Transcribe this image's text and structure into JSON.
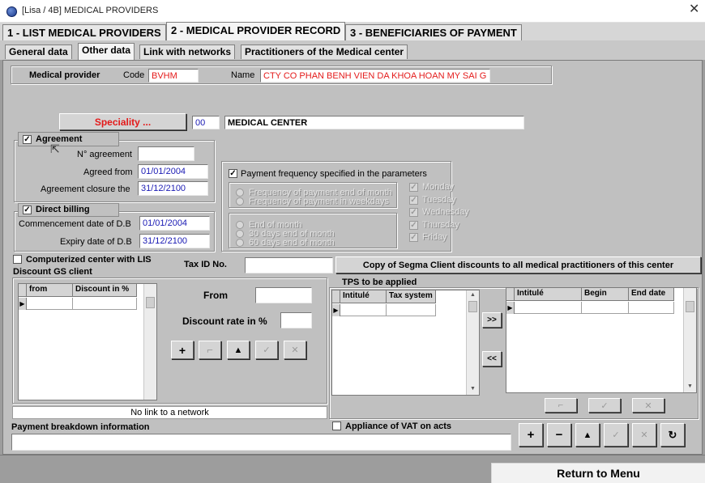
{
  "window": {
    "title": "[Lisa / 4B] MEDICAL PROVIDERS",
    "close": "✕"
  },
  "main_tabs": [
    {
      "label": "1 - LIST MEDICAL PROVIDERS"
    },
    {
      "label": "2 - MEDICAL PROVIDER RECORD"
    },
    {
      "label": "3 - BENEFICIARIES OF PAYMENT"
    }
  ],
  "sub_tabs": [
    {
      "label": "General data"
    },
    {
      "label": "Other data"
    },
    {
      "label": "Link with networks"
    },
    {
      "label": "Practitioners of the Medical center"
    }
  ],
  "provider": {
    "section_label": "Medical provider",
    "code_label": "Code",
    "code_value": "BVHM",
    "name_label": "Name",
    "name_value": "CTY CO PHAN BENH VIEN DA KHOA HOAN MY SAI G"
  },
  "speciality": {
    "button": "Speciality ...",
    "code": "00",
    "name": "MEDICAL CENTER"
  },
  "agreement": {
    "title": "Agreement",
    "checked": true,
    "number_label": "N° agreement",
    "number_value": "",
    "from_label": "Agreed from",
    "from_value": "01/01/2004",
    "closure_label": "Agreement closure the",
    "closure_value": "31/12/2100"
  },
  "direct_billing": {
    "title": "Direct billing",
    "checked": true,
    "commencement_label": "Commencement date of D.B",
    "commencement_value": "01/01/2004",
    "expiry_label": "Expiry date of D.B",
    "expiry_value": "31/12/2100"
  },
  "payment_frequency": {
    "label": "Payment frequency specified in the parameters",
    "checked": true,
    "radios_a": [
      "Frequency of payment end of month",
      "Frequency of payment in weekdays"
    ],
    "radios_b": [
      "End of month",
      "30 days end of month",
      "60 days end of month"
    ],
    "days": [
      "Monday",
      "Tuesday",
      "Wednesday",
      "Thursday",
      "Friday"
    ]
  },
  "computerized": {
    "label": "Computerized center with LIS",
    "checked": false
  },
  "tax": {
    "label": "Tax ID No.",
    "value": ""
  },
  "copy_button": "Copy of Segma Client discounts to all medical practitioners of this center",
  "discount": {
    "title": "Discount GS client",
    "columns": [
      "from",
      "Discount in %"
    ],
    "from_label": "From",
    "from_value": "",
    "rate_label": "Discount rate in %",
    "rate_value": "",
    "buttons": [
      "+",
      "⌐",
      "▲",
      "✓",
      "✕"
    ],
    "no_link": "No link to a network"
  },
  "tps": {
    "title": "TPS to be applied",
    "left_columns": [
      "Intitulé",
      "Tax system"
    ],
    "right_columns": [
      "Intitulé",
      "Begin",
      "End date"
    ],
    "move_right": ">>",
    "move_left": "<<",
    "buttons": [
      "⌐",
      "✓",
      "✕"
    ]
  },
  "payment_breakdown": {
    "label": "Payment breakdown information",
    "value": ""
  },
  "vat": {
    "label": "Appliance of VAT on acts",
    "checked": false
  },
  "bottom_buttons": [
    "+",
    "−",
    "▲",
    "✓",
    "✕",
    "↻"
  ],
  "return_menu": "Return to Menu",
  "row_marker": "▶",
  "scroll_up": "▲",
  "scroll_down": "▼"
}
